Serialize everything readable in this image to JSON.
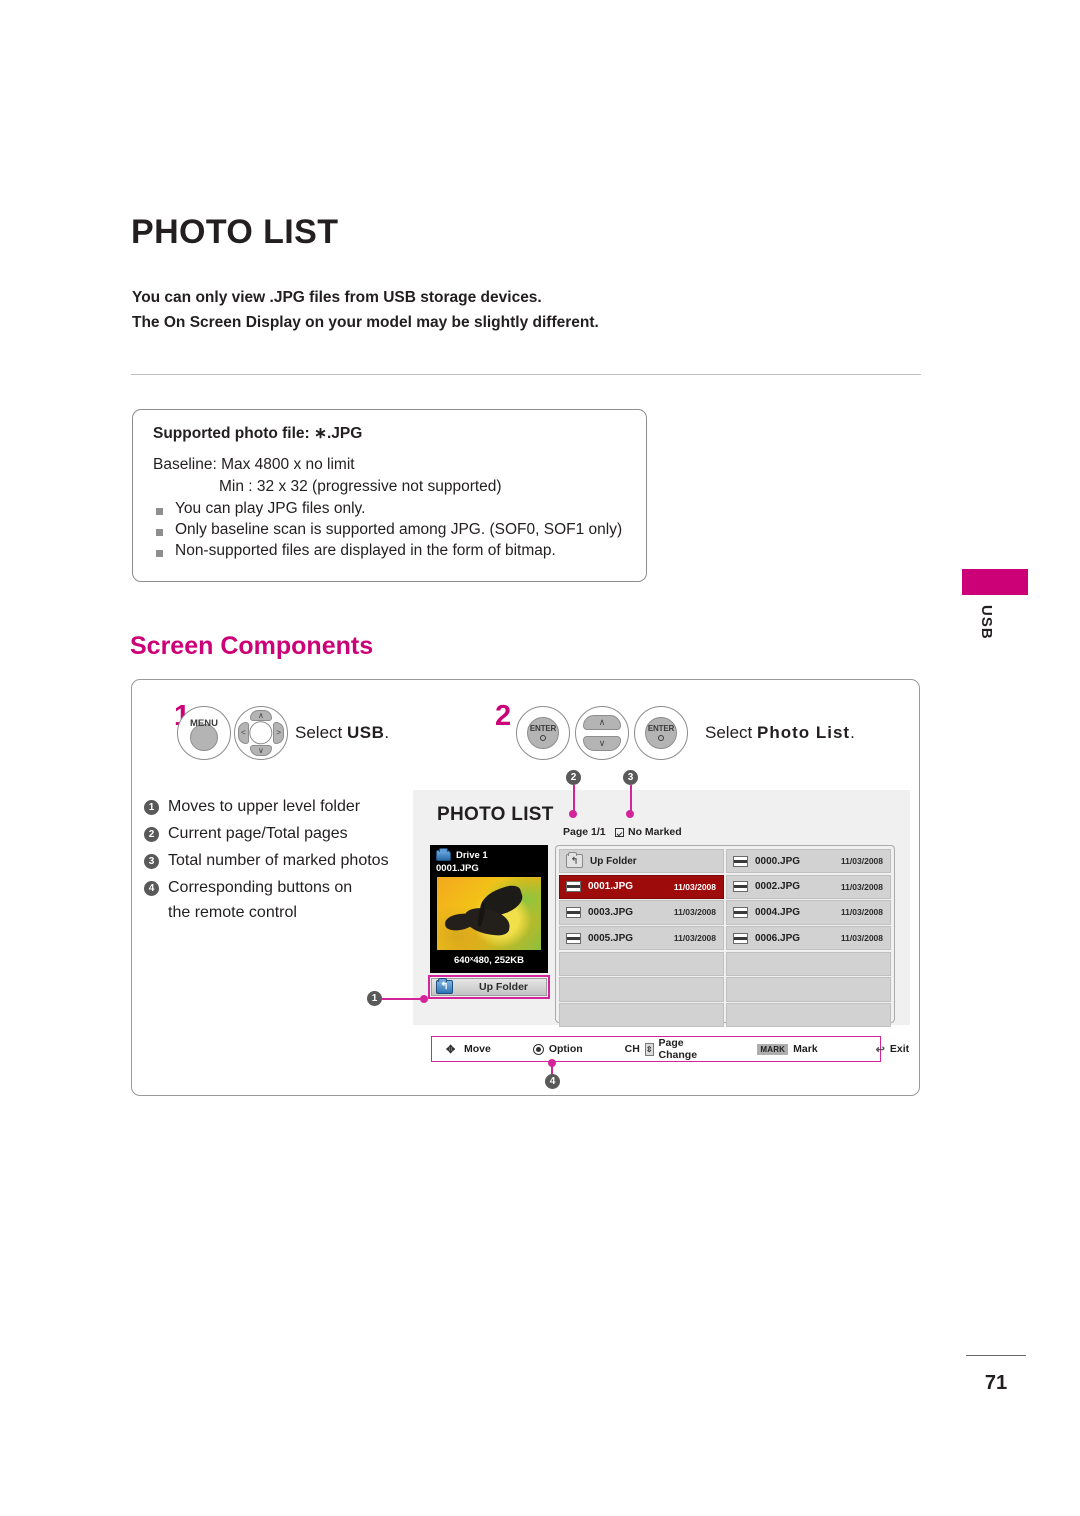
{
  "document": {
    "title": "PHOTO LIST",
    "intro_lines": [
      "You can only view .JPG files from USB storage devices.",
      "The On Screen Display on your model may be slightly different."
    ],
    "page_number": "71",
    "side_tab_label": "USB"
  },
  "spec_box": {
    "title": "Supported photo file: ∗.JPG",
    "line1": "Baseline: Max 4800 x no limit",
    "line2": "Min : 32 x 32 (progressive not supported)",
    "bullets": [
      "You can play JPG files only.",
      "Only baseline scan is supported among JPG. (SOF0, SOF1 only)",
      "Non-supported files are displayed in the form of bitmap."
    ]
  },
  "section": {
    "heading": "Screen Components"
  },
  "steps": [
    {
      "number": "1",
      "buttons": [
        "MENU",
        "d-pad"
      ],
      "instruction_prefix": "Select ",
      "instruction_bold": "USB",
      "instruction_suffix": "."
    },
    {
      "number": "2",
      "buttons": [
        "ENTER",
        "up-down-pad",
        "ENTER"
      ],
      "instruction_prefix": "Select ",
      "instruction_bold": "Photo List",
      "instruction_suffix": "."
    }
  ],
  "remote": {
    "menu_label": "MENU",
    "enter_label": "ENTER",
    "arrow_up": "∧",
    "arrow_down": "∨",
    "arrow_left": "<",
    "arrow_right": ">"
  },
  "legend": [
    {
      "num": "1",
      "text": "Moves to upper level folder",
      "cont": ""
    },
    {
      "num": "2",
      "text": "Current page/Total pages",
      "cont": ""
    },
    {
      "num": "3",
      "text": "Total number of marked photos",
      "cont": ""
    },
    {
      "num": "4",
      "text": "Corresponding buttons on",
      "cont": "the remote control"
    }
  ],
  "osd": {
    "title": "PHOTO LIST",
    "page_indicator": "Page 1/1",
    "marked_indicator": "No Marked",
    "preview": {
      "drive_label": "Drive 1",
      "file_name": "0001.JPG",
      "meta": "640ˣ480, 252KB"
    },
    "up_folder_button": "Up Folder",
    "file_grid": [
      {
        "kind": "folder",
        "name": "Up Folder",
        "date": "",
        "selected": false
      },
      {
        "kind": "jpg",
        "name": "0000.JPG",
        "date": "11/03/2008",
        "selected": false
      },
      {
        "kind": "jpg",
        "name": "0001.JPG",
        "date": "11/03/2008",
        "selected": true
      },
      {
        "kind": "jpg",
        "name": "0002.JPG",
        "date": "11/03/2008",
        "selected": false
      },
      {
        "kind": "jpg",
        "name": "0003.JPG",
        "date": "11/03/2008",
        "selected": false
      },
      {
        "kind": "jpg",
        "name": "0004.JPG",
        "date": "11/03/2008",
        "selected": false
      },
      {
        "kind": "jpg",
        "name": "0005.JPG",
        "date": "11/03/2008",
        "selected": false
      },
      {
        "kind": "jpg",
        "name": "0006.JPG",
        "date": "11/03/2008",
        "selected": false
      },
      {
        "kind": "empty",
        "name": "",
        "date": "",
        "selected": false
      },
      {
        "kind": "empty",
        "name": "",
        "date": "",
        "selected": false
      },
      {
        "kind": "empty",
        "name": "",
        "date": "",
        "selected": false
      },
      {
        "kind": "empty",
        "name": "",
        "date": "",
        "selected": false
      },
      {
        "kind": "empty",
        "name": "",
        "date": "",
        "selected": false
      },
      {
        "kind": "empty",
        "name": "",
        "date": "",
        "selected": false
      }
    ],
    "toolbar": [
      {
        "icon": "move-icon",
        "label": "Move"
      },
      {
        "icon": "option-icon",
        "label": "Option"
      },
      {
        "icon": "page-change-icon",
        "label": "Page Change",
        "prefix": "CH"
      },
      {
        "icon": "mark-icon",
        "label": "Mark",
        "badge": "MARK"
      },
      {
        "icon": "exit-icon",
        "label": "Exit"
      }
    ]
  },
  "colors": {
    "accent_magenta": "#cc0077",
    "callout_pink": "#d4249a",
    "selected_row": "#9e0b0b",
    "bullet_gray": "#595959"
  }
}
